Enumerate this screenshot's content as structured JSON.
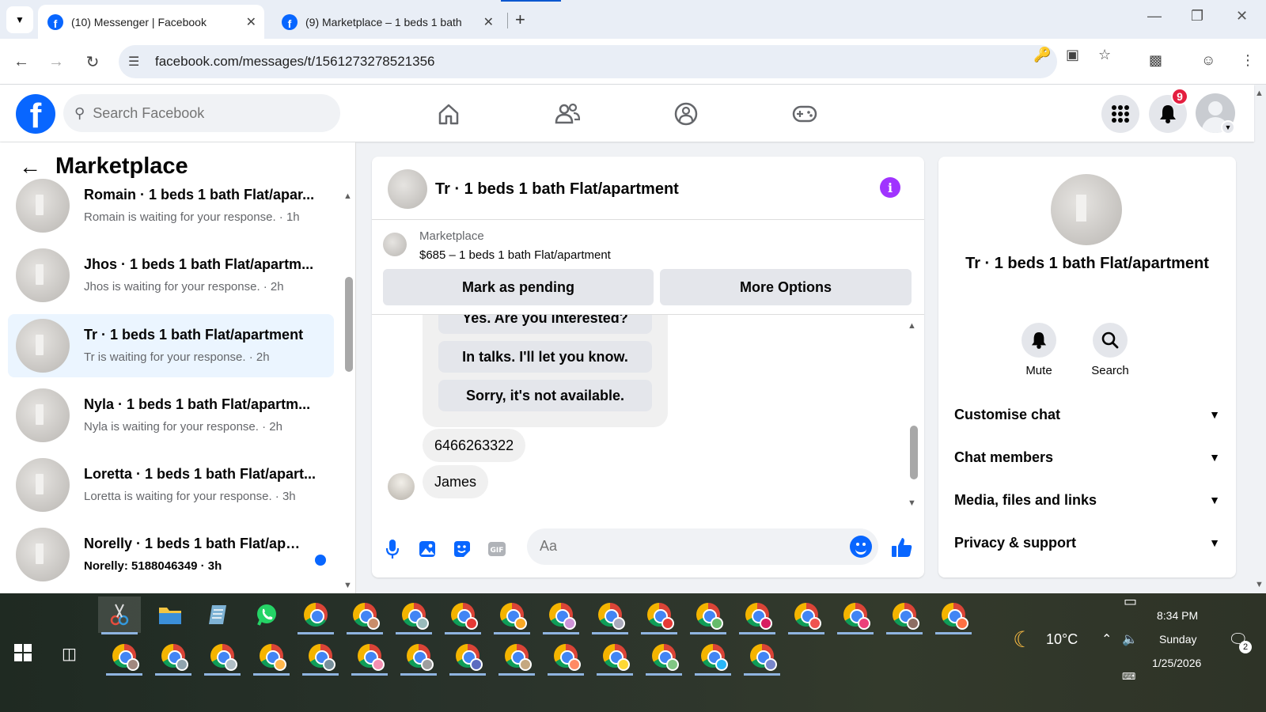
{
  "browser": {
    "tabs": [
      {
        "title": "(10) Messenger | Facebook",
        "active": true
      },
      {
        "title": "(9) Marketplace – 1 beds 1 bath",
        "active": false
      }
    ],
    "url": "facebook.com/messages/t/1561273278521356"
  },
  "fb": {
    "search_placeholder": "Search Facebook",
    "notification_count": "9"
  },
  "left": {
    "title": "Marketplace",
    "conversations": [
      {
        "name": "Romain · 1 beds 1 bath Flat/apar...",
        "sub": "Romain is waiting for your response. · 1h",
        "selected": false,
        "unread": false
      },
      {
        "name": "Jhos · 1 beds 1 bath Flat/apartm...",
        "sub": "Jhos is waiting for your response. · 2h",
        "selected": false,
        "unread": false
      },
      {
        "name": "Tr · 1 beds 1 bath Flat/apartment",
        "sub": "Tr is waiting for your response. · 2h",
        "selected": true,
        "unread": false
      },
      {
        "name": "Nyla · 1 beds 1 bath Flat/apartm...",
        "sub": "Nyla is waiting for your response. · 2h",
        "selected": false,
        "unread": false
      },
      {
        "name": "Loretta · 1 beds 1 bath Flat/apart...",
        "sub": "Loretta is waiting for your response. · 3h",
        "selected": false,
        "unread": false
      },
      {
        "name": "Norelly · 1 beds 1 bath Flat/apa...",
        "sub": "Norelly: 5188046349 · 3h",
        "selected": false,
        "unread": true
      }
    ]
  },
  "chat": {
    "title": "Tr · 1 beds 1 bath Flat/apartment",
    "listing_kind": "Marketplace",
    "listing_price": "$685 – 1 beds 1 bath Flat/apartment",
    "mark_pending": "Mark as pending",
    "more_options": "More Options",
    "quick_replies": [
      "Yes. Are you interested?",
      "In talks. I'll let you know.",
      "Sorry, it's not available."
    ],
    "messages": [
      "6466263322",
      "James"
    ],
    "composer_placeholder": "Aa"
  },
  "right": {
    "name": "Tr · 1 beds 1 bath Flat/apartment",
    "actions": [
      "Mute",
      "Search"
    ],
    "sections": [
      "Customise chat",
      "Chat members",
      "Media, files and links",
      "Privacy & support"
    ]
  },
  "taskbar": {
    "temperature": "10°C",
    "time": "8:34 PM",
    "day": "Sunday",
    "date": "1/25/2026",
    "notifications": "2"
  }
}
